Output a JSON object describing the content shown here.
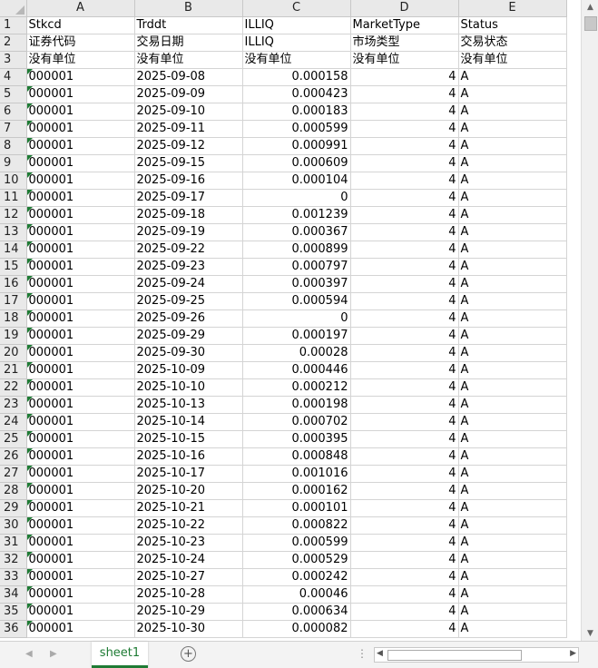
{
  "columns": [
    "A",
    "B",
    "C",
    "D",
    "E"
  ],
  "header_rows": [
    [
      "Stkcd",
      "Trddt",
      "ILLIQ",
      "MarketType",
      "Status"
    ],
    [
      "证券代码",
      "交易日期",
      "ILLIQ",
      "市场类型",
      "交易状态"
    ],
    [
      "没有单位",
      "没有单位",
      "没有单位",
      "没有单位",
      "没有单位"
    ]
  ],
  "data_rows": [
    [
      "000001",
      "2025-09-08",
      "0.000158",
      "4",
      "A"
    ],
    [
      "000001",
      "2025-09-09",
      "0.000423",
      "4",
      "A"
    ],
    [
      "000001",
      "2025-09-10",
      "0.000183",
      "4",
      "A"
    ],
    [
      "000001",
      "2025-09-11",
      "0.000599",
      "4",
      "A"
    ],
    [
      "000001",
      "2025-09-12",
      "0.000991",
      "4",
      "A"
    ],
    [
      "000001",
      "2025-09-15",
      "0.000609",
      "4",
      "A"
    ],
    [
      "000001",
      "2025-09-16",
      "0.000104",
      "4",
      "A"
    ],
    [
      "000001",
      "2025-09-17",
      "0",
      "4",
      "A"
    ],
    [
      "000001",
      "2025-09-18",
      "0.001239",
      "4",
      "A"
    ],
    [
      "000001",
      "2025-09-19",
      "0.000367",
      "4",
      "A"
    ],
    [
      "000001",
      "2025-09-22",
      "0.000899",
      "4",
      "A"
    ],
    [
      "000001",
      "2025-09-23",
      "0.000797",
      "4",
      "A"
    ],
    [
      "000001",
      "2025-09-24",
      "0.000397",
      "4",
      "A"
    ],
    [
      "000001",
      "2025-09-25",
      "0.000594",
      "4",
      "A"
    ],
    [
      "000001",
      "2025-09-26",
      "0",
      "4",
      "A"
    ],
    [
      "000001",
      "2025-09-29",
      "0.000197",
      "4",
      "A"
    ],
    [
      "000001",
      "2025-09-30",
      "0.00028",
      "4",
      "A"
    ],
    [
      "000001",
      "2025-10-09",
      "0.000446",
      "4",
      "A"
    ],
    [
      "000001",
      "2025-10-10",
      "0.000212",
      "4",
      "A"
    ],
    [
      "000001",
      "2025-10-13",
      "0.000198",
      "4",
      "A"
    ],
    [
      "000001",
      "2025-10-14",
      "0.000702",
      "4",
      "A"
    ],
    [
      "000001",
      "2025-10-15",
      "0.000395",
      "4",
      "A"
    ],
    [
      "000001",
      "2025-10-16",
      "0.000848",
      "4",
      "A"
    ],
    [
      "000001",
      "2025-10-17",
      "0.001016",
      "4",
      "A"
    ],
    [
      "000001",
      "2025-10-20",
      "0.000162",
      "4",
      "A"
    ],
    [
      "000001",
      "2025-10-21",
      "0.000101",
      "4",
      "A"
    ],
    [
      "000001",
      "2025-10-22",
      "0.000822",
      "4",
      "A"
    ],
    [
      "000001",
      "2025-10-23",
      "0.000599",
      "4",
      "A"
    ],
    [
      "000001",
      "2025-10-24",
      "0.000529",
      "4",
      "A"
    ],
    [
      "000001",
      "2025-10-27",
      "0.000242",
      "4",
      "A"
    ],
    [
      "000001",
      "2025-10-28",
      "0.00046",
      "4",
      "A"
    ],
    [
      "000001",
      "2025-10-29",
      "0.000634",
      "4",
      "A"
    ],
    [
      "000001",
      "2025-10-30",
      "0.000082",
      "4",
      "A"
    ]
  ],
  "sheet_tab": "sheet1",
  "add_sheet_icon": "+",
  "colors": {
    "accent": "#1e7b34",
    "header_bg": "#e9e9e9",
    "grid_line": "#d4d4d4"
  }
}
